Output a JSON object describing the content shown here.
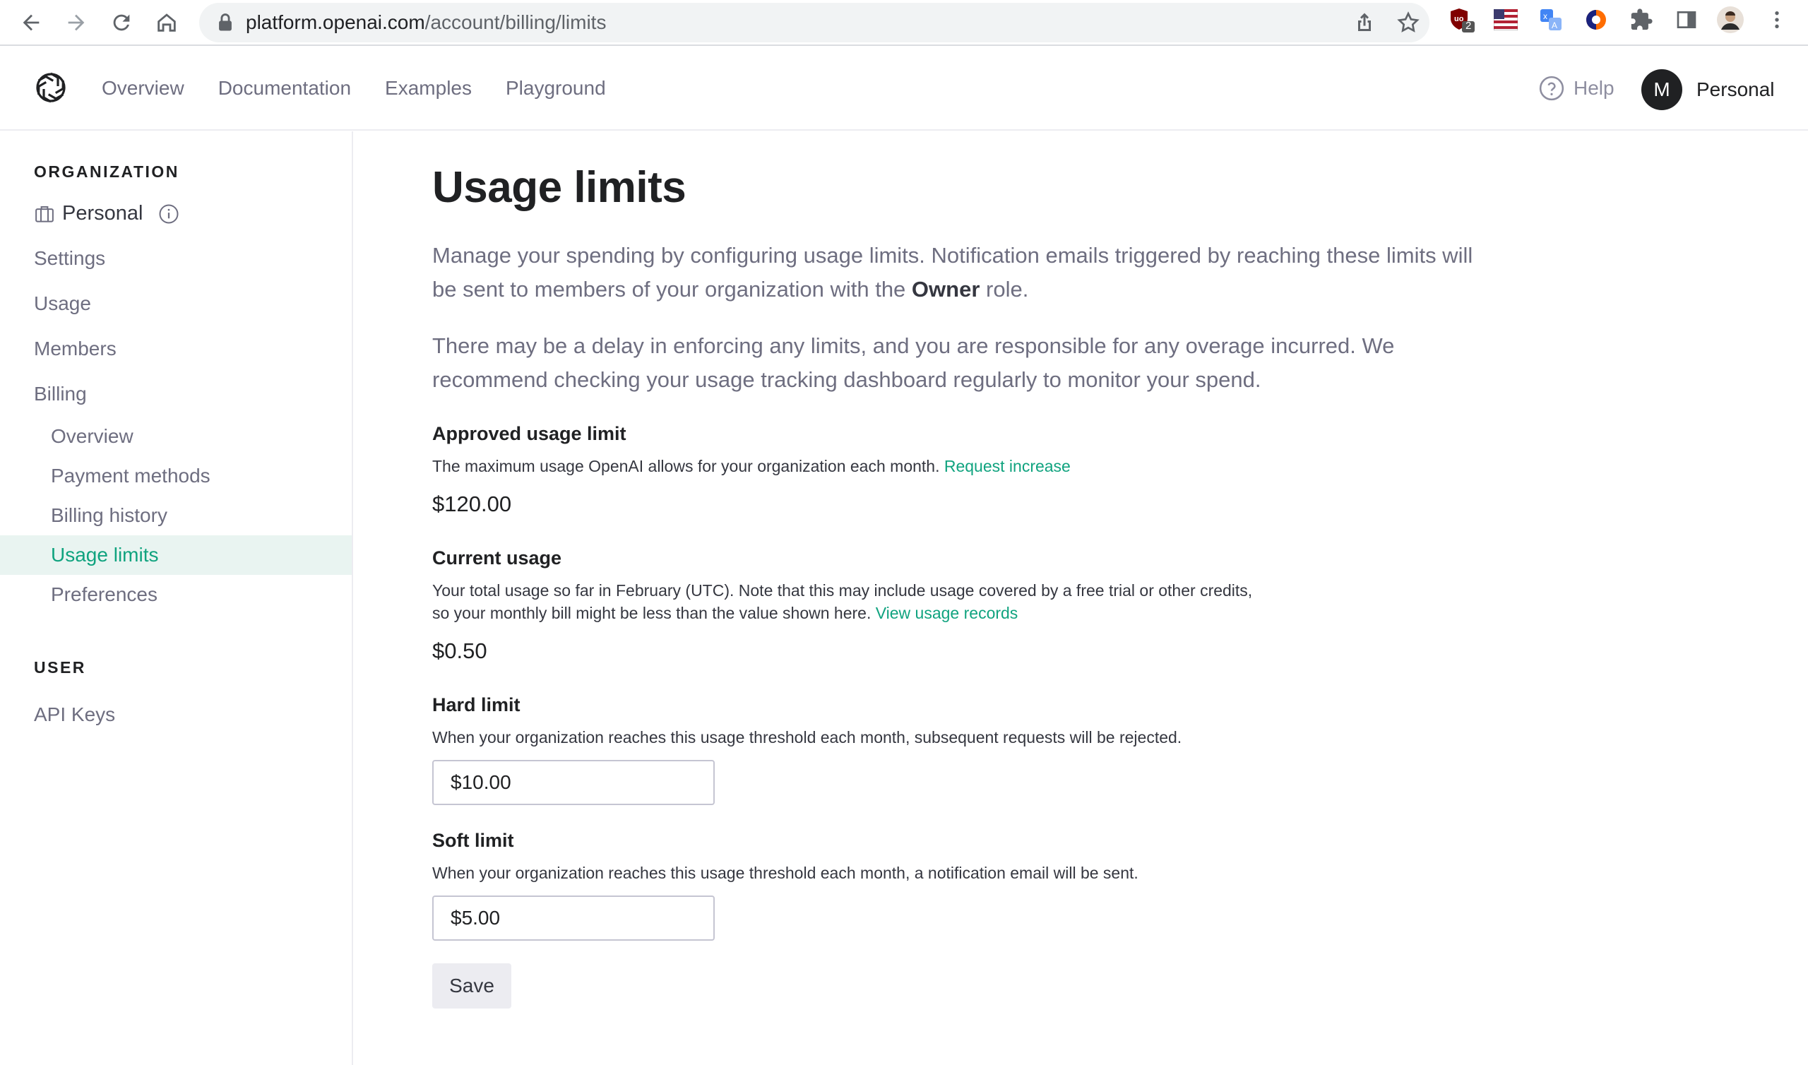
{
  "browser": {
    "url_host": "platform.openai.com",
    "url_path": "/account/billing/limits",
    "ublock_badge": "2"
  },
  "header": {
    "nav": [
      "Overview",
      "Documentation",
      "Examples",
      "Playground"
    ],
    "help_label": "Help",
    "avatar_initial": "M",
    "account_name": "Personal"
  },
  "sidebar": {
    "org_heading": "ORGANIZATION",
    "org_name": "Personal",
    "items": [
      "Settings",
      "Usage",
      "Members",
      "Billing"
    ],
    "billing_items": [
      "Overview",
      "Payment methods",
      "Billing history",
      "Usage limits",
      "Preferences"
    ],
    "active_item": "Usage limits",
    "user_heading": "USER",
    "user_items": [
      "API Keys"
    ]
  },
  "main": {
    "title": "Usage limits",
    "intro_1_before": "Manage your spending by configuring usage limits. Notification emails triggered by reaching these limits will be sent to members of your organization with the ",
    "intro_1_bold": "Owner",
    "intro_1_after": " role.",
    "intro_2": "There may be a delay in enforcing any limits, and you are responsible for any overage incurred. We recommend checking your usage tracking dashboard regularly to monitor your spend.",
    "approved": {
      "title": "Approved usage limit",
      "desc": "The maximum usage OpenAI allows for your organization each month. ",
      "link": "Request increase",
      "value": "$120.00"
    },
    "current": {
      "title": "Current usage",
      "desc": "Your total usage so far in February (UTC). Note that this may include usage covered by a free trial or other credits, so your monthly bill might be less than the value shown here. ",
      "link": "View usage records",
      "value": "$0.50"
    },
    "hard_limit": {
      "title": "Hard limit",
      "desc": "When your organization reaches this usage threshold each month, subsequent requests will be rejected.",
      "value": "$10.00"
    },
    "soft_limit": {
      "title": "Soft limit",
      "desc": "When your organization reaches this usage threshold each month, a notification email will be sent.",
      "value": "$5.00"
    },
    "save_label": "Save"
  },
  "colors": {
    "accent": "#10a37f",
    "active_bg": "#e9f4f1",
    "text": "#353740",
    "muted": "#6e6e80"
  }
}
